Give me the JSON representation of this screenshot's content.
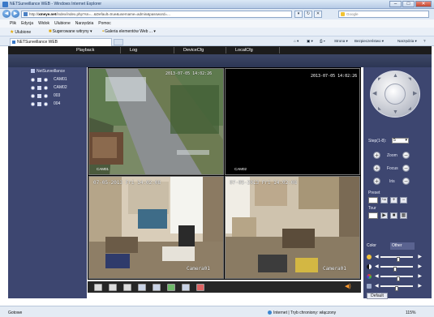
{
  "browser": {
    "window_title": "NETSurveillance WEB - Windows Internet Explorer",
    "url_prefix": "http://",
    "url_domain": "xmeye.net",
    "url_rest": "/index/index.php?sn=...&Default=true&username=admin&password=...",
    "search_placeholder": "Google",
    "menu": [
      "Plik",
      "Edycja",
      "Widok",
      "Ulubione",
      "Narzędzia",
      "Pomoc"
    ],
    "favorites_label": "Ulubione",
    "favorites_items": [
      "Sugerowane witryny ▾",
      "Galeria elementów Web ... ▾"
    ],
    "tab_title": "NETSurveillance WEB",
    "command_items": [
      "Strona ▾",
      "Bezpieczeństwo ▾",
      "Narzędzia ▾"
    ],
    "status_left": "Gotowe",
    "status_zone": "Internet | Tryb chroniony: włączony",
    "zoom": "115%"
  },
  "app": {
    "nav": [
      "Playback",
      "Log",
      "DeviceCfg",
      "LocalCfg"
    ],
    "tree_root": "NetSurveillance",
    "cameras": [
      "CAM01",
      "CAM02",
      "003",
      "004"
    ],
    "video": {
      "cells": [
        {
          "name": "CAM01",
          "osd_time": "2013-07-05 14:02:26"
        },
        {
          "name": "CAM02",
          "osd_time": "2013-07-05 14:02:26"
        },
        {
          "name": "Camera01",
          "osd_time": "07-05-2013 Fri 14:02:08"
        },
        {
          "name": "Camera01",
          "osd_time": "07-05-2013 Fri 14:02:08"
        }
      ]
    },
    "ptz": {
      "step_label": "Step(1-8):",
      "step_value": "5",
      "zoom_label": "Zoom",
      "focus_label": "Focus",
      "iris_label": "Iris",
      "preset_label": "Preset",
      "tour_label": "Tour"
    },
    "color": {
      "tab_color": "Color",
      "tab_other": "Other",
      "default_button": "Default",
      "sliders": [
        {
          "icon": "brightness",
          "level": 0.55
        },
        {
          "icon": "contrast",
          "level": 0.45
        },
        {
          "icon": "saturation",
          "level": 0.55
        },
        {
          "icon": "hue",
          "level": 0.5
        }
      ]
    }
  },
  "colors": {
    "panel": "#3d4670",
    "nav_dark": "#1c1c1c",
    "speaker": "#ff9a2e"
  }
}
